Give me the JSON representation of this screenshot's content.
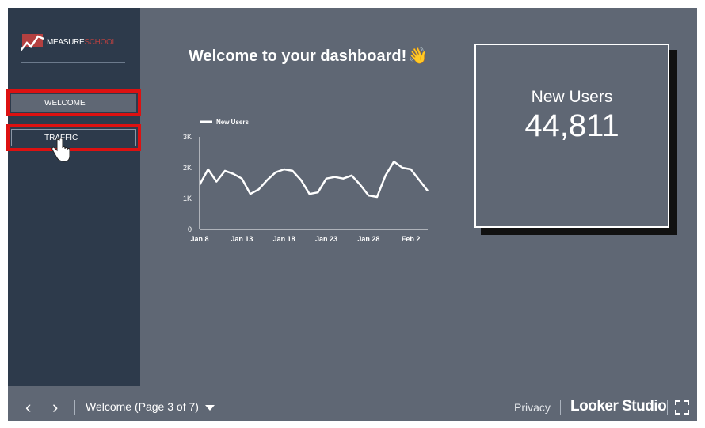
{
  "logo": {
    "text_main": "MEASURE",
    "text_accent": "SCHOOL"
  },
  "nav": {
    "items": [
      {
        "label": "WELCOME"
      },
      {
        "label": "TRAFFIC"
      }
    ]
  },
  "dashboard": {
    "title": "Welcome to your dashboard!",
    "title_emoji": "👋"
  },
  "scorecard": {
    "label": "New Users",
    "value": "44,811"
  },
  "chart_data": {
    "type": "line",
    "title": "",
    "xlabel": "",
    "ylabel": "",
    "legend": "top-left",
    "series": [
      {
        "name": "New Users",
        "values": [
          1450,
          1950,
          1550,
          1900,
          1800,
          1650,
          1150,
          1300,
          1600,
          1850,
          1950,
          1900,
          1600,
          1150,
          1200,
          1650,
          1700,
          1650,
          1750,
          1450,
          1100,
          1050,
          1750,
          2200,
          2000,
          1950,
          1600,
          1250
        ]
      }
    ],
    "x": [
      "Jan 8",
      "Jan 9",
      "Jan 10",
      "Jan 11",
      "Jan 12",
      "Jan 13",
      "Jan 14",
      "Jan 15",
      "Jan 16",
      "Jan 17",
      "Jan 18",
      "Jan 19",
      "Jan 20",
      "Jan 21",
      "Jan 22",
      "Jan 23",
      "Jan 24",
      "Jan 25",
      "Jan 26",
      "Jan 27",
      "Jan 28",
      "Jan 29",
      "Jan 30",
      "Jan 31",
      "Feb 1",
      "Feb 2",
      "Feb 3",
      "Feb 4"
    ],
    "x_ticks": [
      "Jan 8",
      "Jan 13",
      "Jan 18",
      "Jan 23",
      "Jan 28",
      "Feb 2"
    ],
    "y_ticks": [
      "0",
      "1K",
      "2K",
      "3K"
    ],
    "ylim": [
      0,
      3000
    ],
    "grid": false
  },
  "footer": {
    "prev_label": "‹",
    "next_label": "›",
    "page_label": "Welcome (Page 3 of 7)",
    "privacy_label": "Privacy",
    "brand_label": "Looker Studio"
  }
}
